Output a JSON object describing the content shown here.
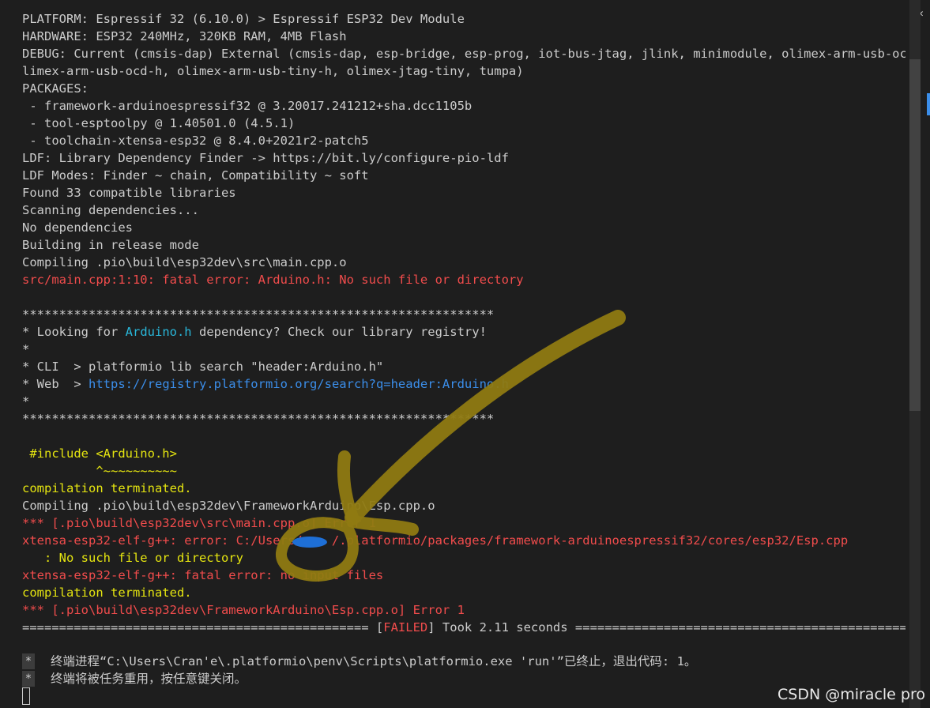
{
  "terminal": {
    "lines": [
      {
        "text": "PLATFORM: Espressif 32 (6.10.0) > Espressif ESP32 Dev Module",
        "style": "normal"
      },
      {
        "text": "HARDWARE: ESP32 240MHz, 320KB RAM, 4MB Flash",
        "style": "normal"
      },
      {
        "text": "DEBUG: Current (cmsis-dap) External (cmsis-dap, esp-bridge, esp-prog, iot-bus-jtag, jlink, minimodule, olimex-arm-usb-ocd, o",
        "style": "normal"
      },
      {
        "text": "limex-arm-usb-ocd-h, olimex-arm-usb-tiny-h, olimex-jtag-tiny, tumpa)",
        "style": "normal"
      },
      {
        "text": "PACKAGES:",
        "style": "normal"
      },
      {
        "text": " - framework-arduinoespressif32 @ 3.20017.241212+sha.dcc1105b",
        "style": "normal"
      },
      {
        "text": " - tool-esptoolpy @ 1.40501.0 (4.5.1)",
        "style": "normal"
      },
      {
        "text": " - toolchain-xtensa-esp32 @ 8.4.0+2021r2-patch5",
        "style": "normal"
      },
      {
        "text": "LDF: Library Dependency Finder -> https://bit.ly/configure-pio-ldf",
        "style": "normal"
      },
      {
        "text": "LDF Modes: Finder ~ chain, Compatibility ~ soft",
        "style": "normal"
      },
      {
        "text": "Found 33 compatible libraries",
        "style": "normal"
      },
      {
        "text": "Scanning dependencies...",
        "style": "normal"
      },
      {
        "text": "No dependencies",
        "style": "normal"
      },
      {
        "text": "Building in release mode",
        "style": "normal"
      },
      {
        "text": "Compiling .pio\\build\\esp32dev\\src\\main.cpp.o",
        "style": "normal"
      },
      {
        "text": "src/main.cpp:1:10: fatal error: Arduino.h: No such file or directory",
        "style": "red"
      },
      {
        "text": "",
        "style": "normal"
      },
      {
        "text": "****************************************************************",
        "style": "normal"
      },
      {
        "segments": [
          {
            "text": "* Looking for ",
            "style": "normal"
          },
          {
            "text": "Arduino.h",
            "style": "cyan"
          },
          {
            "text": " dependency? Check our library registry!",
            "style": "normal"
          }
        ]
      },
      {
        "text": "*",
        "style": "normal"
      },
      {
        "text": "* CLI  > platformio lib search \"header:Arduino.h\"",
        "style": "normal"
      },
      {
        "segments": [
          {
            "text": "* Web  > ",
            "style": "normal"
          },
          {
            "text": "https://registry.platformio.org/search?q=header:Arduino.h",
            "style": "link"
          }
        ]
      },
      {
        "text": "*",
        "style": "normal"
      },
      {
        "text": "****************************************************************",
        "style": "normal"
      },
      {
        "text": "",
        "style": "normal"
      },
      {
        "text": " #include <Arduino.h>",
        "style": "yellow"
      },
      {
        "text": "          ^~~~~~~~~~~",
        "style": "yellow"
      },
      {
        "text": "compilation terminated.",
        "style": "yellow"
      },
      {
        "text": "Compiling .pio\\build\\esp32dev\\FrameworkArduino\\Esp.cpp.o",
        "style": "normal"
      },
      {
        "text": "*** [.pio\\build\\esp32dev\\src\\main.cpp.o] Error 1",
        "style": "red"
      },
      {
        "text": "xtensa-esp32-elf-g++: error: C:/Users/    /.platformio/packages/framework-arduinoespressif32/cores/esp32/Esp.cpp",
        "style": "red"
      },
      {
        "text": "   : No such file or directory",
        "style": "yellow"
      },
      {
        "text": "xtensa-esp32-elf-g++: fatal error: no input files",
        "style": "red"
      },
      {
        "text": "compilation terminated.",
        "style": "yellow"
      },
      {
        "text": "*** [.pio\\build\\esp32dev\\FrameworkArduino\\Esp.cpp.o] Error 1",
        "style": "red"
      },
      {
        "segments": [
          {
            "text": "=============================================== [",
            "style": "normal"
          },
          {
            "text": "FAILED",
            "style": "red"
          },
          {
            "text": "] Took 2.11 seconds ===============================================",
            "style": "normal"
          }
        ]
      }
    ]
  },
  "footer": {
    "mark": "*",
    "line1": "终端进程“C:\\Users\\Cran'e\\.platformio\\penv\\Scripts\\platformio.exe 'run'”已终止，退出代码: 1。",
    "line2": "终端将被任务重用，按任意键关闭。"
  },
  "watermark": "CSDN @miracle pro",
  "colors": {
    "background": "#1e1e1e",
    "text": "#cccccc",
    "error": "#f14c4c",
    "warning": "#e5e510",
    "annotation_arrow": "#9c8514",
    "annotation_smudge": "#1e6fd6"
  }
}
